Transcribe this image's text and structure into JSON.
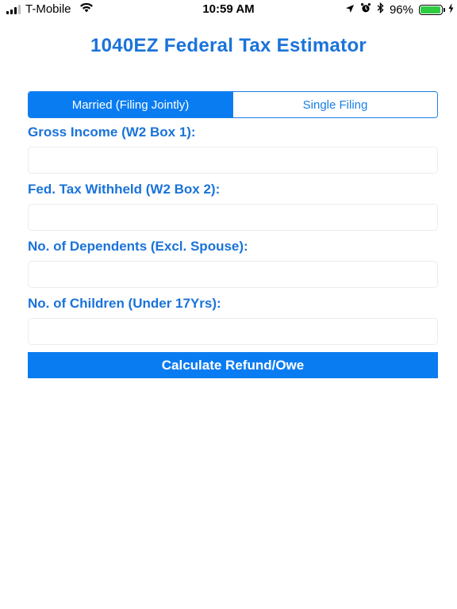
{
  "status_bar": {
    "carrier": "T-Mobile",
    "time": "10:59 AM",
    "battery_percent": "96%",
    "battery_level": 0.96,
    "signal_bars": 3,
    "icons": [
      "signal-icon",
      "wifi-icon",
      "location-icon",
      "alarm-icon",
      "bluetooth-icon",
      "battery-icon",
      "charging-icon"
    ]
  },
  "header": {
    "title": "1040EZ Federal Tax Estimator"
  },
  "filing_status": {
    "options": [
      "Married (Filing Jointly)",
      "Single Filing"
    ],
    "selected": "Married (Filing Jointly)"
  },
  "form": {
    "gross_income_label": "Gross Income (W2 Box 1):",
    "gross_income_value": "",
    "withheld_label": "Fed. Tax Withheld (W2 Box 2):",
    "withheld_value": "",
    "dependents_label": "No. of Dependents (Excl. Spouse):",
    "dependents_value": "",
    "children_label": "No. of Children (Under 17Yrs):",
    "children_value": ""
  },
  "actions": {
    "calculate_label": "Calculate Refund/Owe"
  },
  "colors": {
    "accent": "#0a7cf2",
    "label": "#1a73d9",
    "battery": "#2ecc40"
  }
}
